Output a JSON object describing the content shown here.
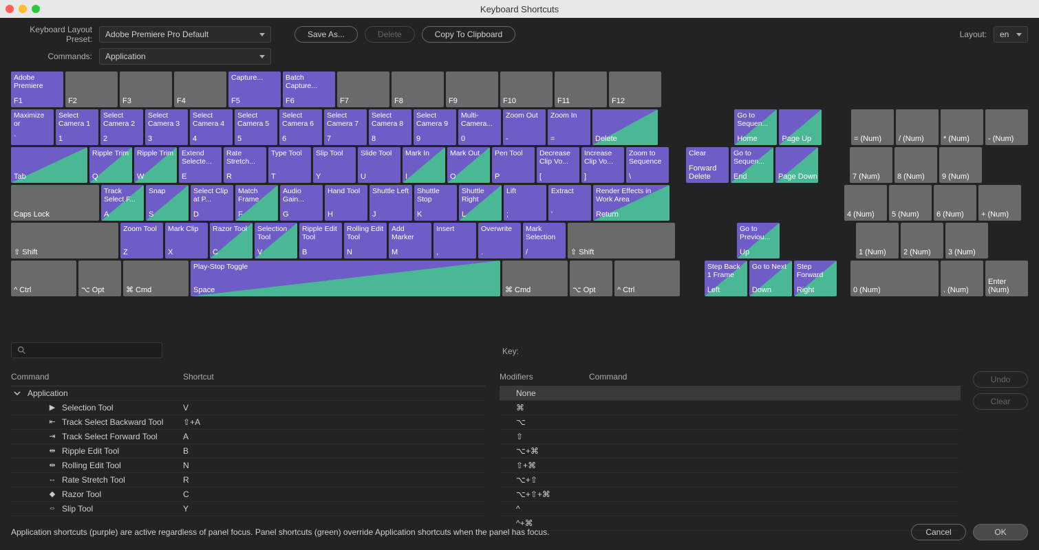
{
  "window": {
    "title": "Keyboard Shortcuts"
  },
  "labels": {
    "layoutPreset": "Keyboard Layout Preset:",
    "commands": "Commands:",
    "layout": "Layout:",
    "key": "Key:",
    "command": "Command",
    "shortcut": "Shortcut",
    "modifiers": "Modifiers"
  },
  "selects": {
    "preset": "Adobe Premiere Pro Default",
    "commands": "Application",
    "layout": "en"
  },
  "buttons": {
    "saveAs": "Save As...",
    "delete": "Delete",
    "copyClipboard": "Copy To Clipboard",
    "undo": "Undo",
    "clear": "Clear",
    "cancel": "Cancel",
    "ok": "OK"
  },
  "keyboard": {
    "row0": [
      {
        "cmd": "Adobe Premiere",
        "kl": "F1",
        "c": "purple",
        "w": "w1"
      },
      {
        "cmd": "",
        "kl": "F2",
        "c": "",
        "w": "w1"
      },
      {
        "cmd": "",
        "kl": "F3",
        "c": "",
        "w": "w1"
      },
      {
        "cmd": "",
        "kl": "F4",
        "c": "",
        "w": "w1"
      },
      {
        "cmd": "Capture...",
        "kl": "F5",
        "c": "purple",
        "w": "w1"
      },
      {
        "cmd": "Batch Capture...",
        "kl": "F6",
        "c": "purple",
        "w": "w1"
      },
      {
        "cmd": "",
        "kl": "F7",
        "c": "",
        "w": "w1"
      },
      {
        "cmd": "",
        "kl": "F8",
        "c": "",
        "w": "w1"
      },
      {
        "cmd": "",
        "kl": "F9",
        "c": "",
        "w": "w1"
      },
      {
        "cmd": "",
        "kl": "F10",
        "c": "",
        "w": "w1"
      },
      {
        "cmd": "",
        "kl": "F11",
        "c": "",
        "w": "w1"
      },
      {
        "cmd": "",
        "kl": "F12",
        "c": "",
        "w": "w1"
      }
    ],
    "row1": [
      {
        "cmd": "Maximize or",
        "kl": "`",
        "c": "purple",
        "w": "w1"
      },
      {
        "cmd": "Select Camera 1",
        "kl": "1",
        "c": "purple",
        "w": "w1"
      },
      {
        "cmd": "Select Camera 2",
        "kl": "2",
        "c": "purple",
        "w": "w1"
      },
      {
        "cmd": "Select Camera 3",
        "kl": "3",
        "c": "purple",
        "w": "w1"
      },
      {
        "cmd": "Select Camera 4",
        "kl": "4",
        "c": "purple",
        "w": "w1"
      },
      {
        "cmd": "Select Camera 5",
        "kl": "5",
        "c": "purple",
        "w": "w1"
      },
      {
        "cmd": "Select Camera 6",
        "kl": "6",
        "c": "purple",
        "w": "w1"
      },
      {
        "cmd": "Select Camera 7",
        "kl": "7",
        "c": "purple",
        "w": "w1"
      },
      {
        "cmd": "Select Camera 8",
        "kl": "8",
        "c": "purple",
        "w": "w1"
      },
      {
        "cmd": "Select Camera 9",
        "kl": "9",
        "c": "purple",
        "w": "w1"
      },
      {
        "cmd": "Multi-Camera...",
        "kl": "0",
        "c": "purple",
        "w": "w1"
      },
      {
        "cmd": "Zoom Out",
        "kl": "-",
        "c": "purple",
        "w": "w1"
      },
      {
        "cmd": "Zoom In",
        "kl": "=",
        "c": "purple",
        "w": "w1"
      },
      {
        "cmd": "",
        "kl": "Delete",
        "c": "half",
        "w": "w15"
      }
    ],
    "row1b": [
      {
        "cmd": "Go to Sequen...",
        "kl": "Home",
        "c": "half",
        "w": "w1"
      },
      {
        "cmd": "",
        "kl": "Page Up",
        "c": "half",
        "w": "w1"
      }
    ],
    "row1c": [
      {
        "cmd": "",
        "kl": "= (Num)",
        "c": "",
        "w": "w1"
      },
      {
        "cmd": "",
        "kl": "/ (Num)",
        "c": "",
        "w": "w1"
      },
      {
        "cmd": "",
        "kl": "* (Num)",
        "c": "",
        "w": "w1"
      },
      {
        "cmd": "",
        "kl": "- (Num)",
        "c": "",
        "w": "w1"
      }
    ],
    "row2": [
      {
        "cmd": "",
        "kl": "Tab",
        "c": "half",
        "w": "w175"
      },
      {
        "cmd": "Ripple Trim",
        "kl": "Q",
        "c": "half",
        "w": "w1"
      },
      {
        "cmd": "Ripple Trim",
        "kl": "W",
        "c": "half",
        "w": "w1"
      },
      {
        "cmd": "Extend Selecte...",
        "kl": "E",
        "c": "purple",
        "w": "w1"
      },
      {
        "cmd": "Rate Stretch...",
        "kl": "R",
        "c": "purple",
        "w": "w1"
      },
      {
        "cmd": "Type Tool",
        "kl": "T",
        "c": "purple",
        "w": "w1"
      },
      {
        "cmd": "Slip Tool",
        "kl": "Y",
        "c": "purple",
        "w": "w1"
      },
      {
        "cmd": "Slide Tool",
        "kl": "U",
        "c": "purple",
        "w": "w1"
      },
      {
        "cmd": "Mark In",
        "kl": "I",
        "c": "half",
        "w": "w1"
      },
      {
        "cmd": "Mark Out",
        "kl": "O",
        "c": "half",
        "w": "w1"
      },
      {
        "cmd": "Pen Tool",
        "kl": "P",
        "c": "purple",
        "w": "w1"
      },
      {
        "cmd": "Decrease Clip Vo...",
        "kl": "[",
        "c": "purple",
        "w": "w1"
      },
      {
        "cmd": "Increase Clip Vo...",
        "kl": "]",
        "c": "purple",
        "w": "w1"
      },
      {
        "cmd": "Zoom to Sequence",
        "kl": "\\",
        "c": "purple",
        "w": "w1"
      }
    ],
    "row2b": [
      {
        "cmd": "Clear",
        "kl": "Forward Delete",
        "c": "purple",
        "w": "w1"
      },
      {
        "cmd": "Go to Sequen...",
        "kl": "End",
        "c": "half",
        "w": "w1"
      },
      {
        "cmd": "",
        "kl": "Page Down",
        "c": "half",
        "w": "w1"
      }
    ],
    "row2c": [
      {
        "cmd": "",
        "kl": "7 (Num)",
        "c": "",
        "w": "w1"
      },
      {
        "cmd": "",
        "kl": "8 (Num)",
        "c": "",
        "w": "w1"
      },
      {
        "cmd": "",
        "kl": "9 (Num)",
        "c": "",
        "w": "w1"
      }
    ],
    "row3": [
      {
        "cmd": "",
        "kl": "Caps Lock",
        "c": "",
        "w": "w2"
      },
      {
        "cmd": "Track Select F...",
        "kl": "A",
        "c": "half",
        "w": "w1"
      },
      {
        "cmd": "Snap",
        "kl": "S",
        "c": "half",
        "w": "w1"
      },
      {
        "cmd": "Select Clip at P...",
        "kl": "D",
        "c": "purple",
        "w": "w1"
      },
      {
        "cmd": "Match Frame",
        "kl": "F",
        "c": "half",
        "w": "w1"
      },
      {
        "cmd": "Audio Gain...",
        "kl": "G",
        "c": "purple",
        "w": "w1"
      },
      {
        "cmd": "Hand Tool",
        "kl": "H",
        "c": "purple",
        "w": "w1"
      },
      {
        "cmd": "Shuttle Left",
        "kl": "J",
        "c": "purple",
        "w": "w1"
      },
      {
        "cmd": "Shuttle Stop",
        "kl": "K",
        "c": "purple",
        "w": "w1"
      },
      {
        "cmd": "Shuttle Right",
        "kl": "L",
        "c": "half",
        "w": "w1"
      },
      {
        "cmd": "Lift",
        "kl": ";",
        "c": "purple",
        "w": "w1"
      },
      {
        "cmd": "Extract",
        "kl": "'",
        "c": "purple",
        "w": "w1"
      },
      {
        "cmd": "Render Effects in Work Area",
        "kl": "Return",
        "c": "half",
        "w": "w175"
      }
    ],
    "row3c": [
      {
        "cmd": "",
        "kl": "4 (Num)",
        "c": "",
        "w": "w1"
      },
      {
        "cmd": "",
        "kl": "5 (Num)",
        "c": "",
        "w": "w1"
      },
      {
        "cmd": "",
        "kl": "6 (Num)",
        "c": "",
        "w": "w1"
      },
      {
        "cmd": "",
        "kl": "+ (Num)",
        "c": "",
        "w": "w1"
      }
    ],
    "row4": [
      {
        "cmd": "",
        "kl": "⇧ Shift",
        "c": "",
        "w": "w225"
      },
      {
        "cmd": "Zoom Tool",
        "kl": "Z",
        "c": "purple",
        "w": "w1"
      },
      {
        "cmd": "Mark Clip",
        "kl": "X",
        "c": "purple",
        "w": "w1"
      },
      {
        "cmd": "Razor Tool",
        "kl": "C",
        "c": "half",
        "w": "w1"
      },
      {
        "cmd": "Selection Tool",
        "kl": "V",
        "c": "half",
        "w": "w1"
      },
      {
        "cmd": "Ripple Edit Tool",
        "kl": "B",
        "c": "purple",
        "w": "w1"
      },
      {
        "cmd": "Rolling Edit Tool",
        "kl": "N",
        "c": "purple",
        "w": "w1"
      },
      {
        "cmd": "Add Marker",
        "kl": "M",
        "c": "purple",
        "w": "w1"
      },
      {
        "cmd": "Insert",
        "kl": ",",
        "c": "purple",
        "w": "w1"
      },
      {
        "cmd": "Overwrite",
        "kl": ".",
        "c": "purple",
        "w": "w1"
      },
      {
        "cmd": "Mark Selection",
        "kl": "/",
        "c": "purple",
        "w": "w1"
      },
      {
        "cmd": "",
        "kl": "⇧ Shift",
        "c": "",
        "w": "w225"
      }
    ],
    "row4b": [
      {
        "cmd": "Go to Previou...",
        "kl": "Up",
        "c": "half",
        "w": "w1"
      }
    ],
    "row4c": [
      {
        "cmd": "",
        "kl": "1 (Num)",
        "c": "",
        "w": "w1"
      },
      {
        "cmd": "",
        "kl": "2 (Num)",
        "c": "",
        "w": "w1"
      },
      {
        "cmd": "",
        "kl": "3 (Num)",
        "c": "",
        "w": "w1"
      }
    ],
    "row5": [
      {
        "cmd": "",
        "kl": "^ Ctrl",
        "c": "",
        "w": "w15"
      },
      {
        "cmd": "",
        "kl": "⌥ Opt",
        "c": "",
        "w": "w1"
      },
      {
        "cmd": "",
        "kl": "⌘ Cmd",
        "c": "",
        "w": "w15"
      },
      {
        "cmd": "Play-Stop Toggle",
        "kl": "Space",
        "c": "half",
        "w": "w6"
      },
      {
        "cmd": "",
        "kl": "⌘ Cmd",
        "c": "",
        "w": "w15"
      },
      {
        "cmd": "",
        "kl": "⌥ Opt",
        "c": "",
        "w": "w1"
      },
      {
        "cmd": "",
        "kl": "^ Ctrl",
        "c": "",
        "w": "w15"
      }
    ],
    "row5b": [
      {
        "cmd": "Step Back 1 Frame",
        "kl": "Left",
        "c": "half",
        "w": "w1"
      },
      {
        "cmd": "Go to Next",
        "kl": "Down",
        "c": "half",
        "w": "w1"
      },
      {
        "cmd": "Step Forward",
        "kl": "Right",
        "c": "half",
        "w": "w1"
      }
    ],
    "row5c": [
      {
        "cmd": "",
        "kl": "0 (Num)",
        "c": "",
        "w": "w2"
      },
      {
        "cmd": "",
        "kl": ". (Num)",
        "c": "",
        "w": "w1"
      },
      {
        "cmd": "",
        "kl": "Enter (Num)",
        "c": "",
        "w": "w1"
      }
    ]
  },
  "commandList": {
    "root": "Application",
    "items": [
      {
        "name": "Selection Tool",
        "sc": "V"
      },
      {
        "name": "Track Select Backward Tool",
        "sc": "⇧+A"
      },
      {
        "name": "Track Select Forward Tool",
        "sc": "A"
      },
      {
        "name": "Ripple Edit Tool",
        "sc": "B"
      },
      {
        "name": "Rolling Edit Tool",
        "sc": "N"
      },
      {
        "name": "Rate Stretch Tool",
        "sc": "R"
      },
      {
        "name": "Razor Tool",
        "sc": "C"
      },
      {
        "name": "Slip Tool",
        "sc": "Y"
      }
    ]
  },
  "modList": [
    "None",
    "⌘",
    "⌥",
    "⇧",
    "⌥+⌘",
    "⇧+⌘",
    "⌥+⇧",
    "⌥+⇧+⌘",
    "^",
    "^+⌘"
  ],
  "help": "Application shortcuts (purple) are active regardless of panel focus. Panel shortcuts (green) override Application shortcuts when the panel has focus."
}
